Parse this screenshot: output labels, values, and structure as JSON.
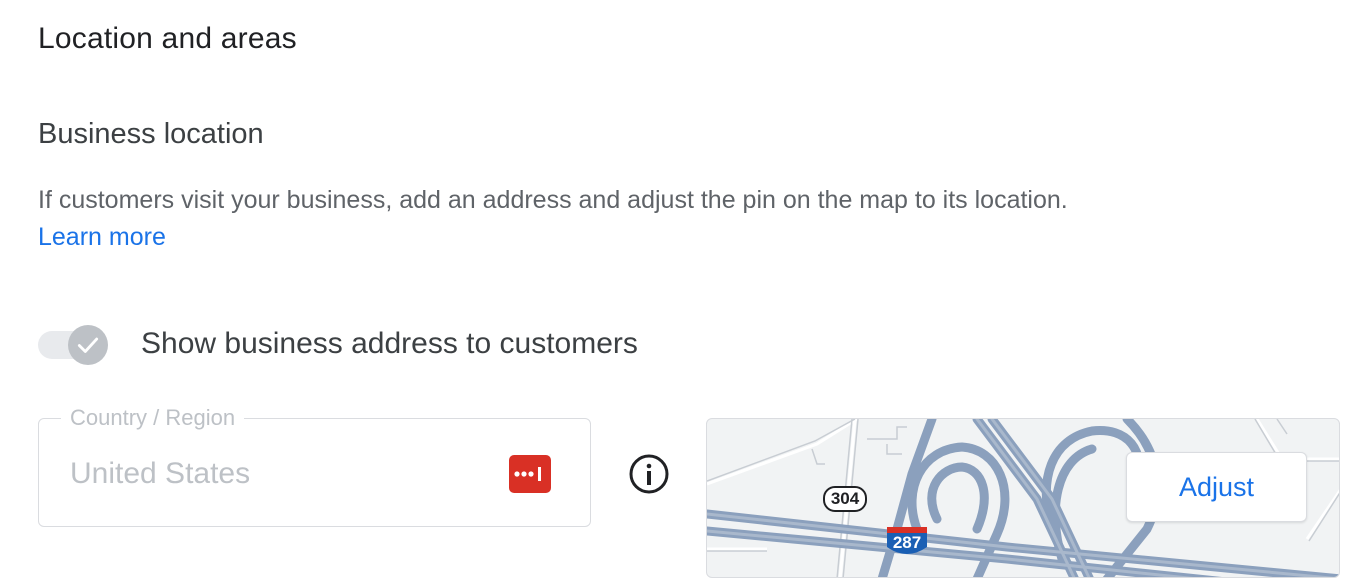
{
  "section": {
    "title": "Location and areas"
  },
  "business_location": {
    "title": "Business location",
    "description": "If customers visit your business, add an address and adjust the pin on the map to its location.",
    "learn_more": "Learn more"
  },
  "toggle": {
    "label": "Show business address to customers",
    "state": "on-disabled",
    "icon": "check-icon"
  },
  "country_field": {
    "label": "Country / Region",
    "value": "United States",
    "icon": "password-manager-icon"
  },
  "info": {
    "icon": "info-icon"
  },
  "map": {
    "route_labels": [
      "304",
      "287"
    ],
    "adjust_button": "Adjust"
  },
  "colors": {
    "link": "#1a73e8",
    "disabled": "#bdc1c6",
    "road": "#8ba0bd",
    "password_icon_bg": "#d93025"
  }
}
